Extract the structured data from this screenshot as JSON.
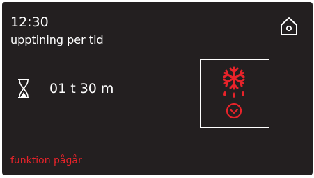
{
  "header": {
    "time": "12:30",
    "mode_label": "upptining per tid"
  },
  "timer": {
    "duration": "01 t 30 m"
  },
  "status": {
    "text": "funktion pågår"
  },
  "icons": {
    "home": "home-icon",
    "hourglass": "hourglass-icon",
    "defrost": "defrost-snowflake-icon",
    "clock": "clock-icon"
  },
  "colors": {
    "background": "#231f20",
    "text": "#ffffff",
    "accent": "#e8232a"
  }
}
